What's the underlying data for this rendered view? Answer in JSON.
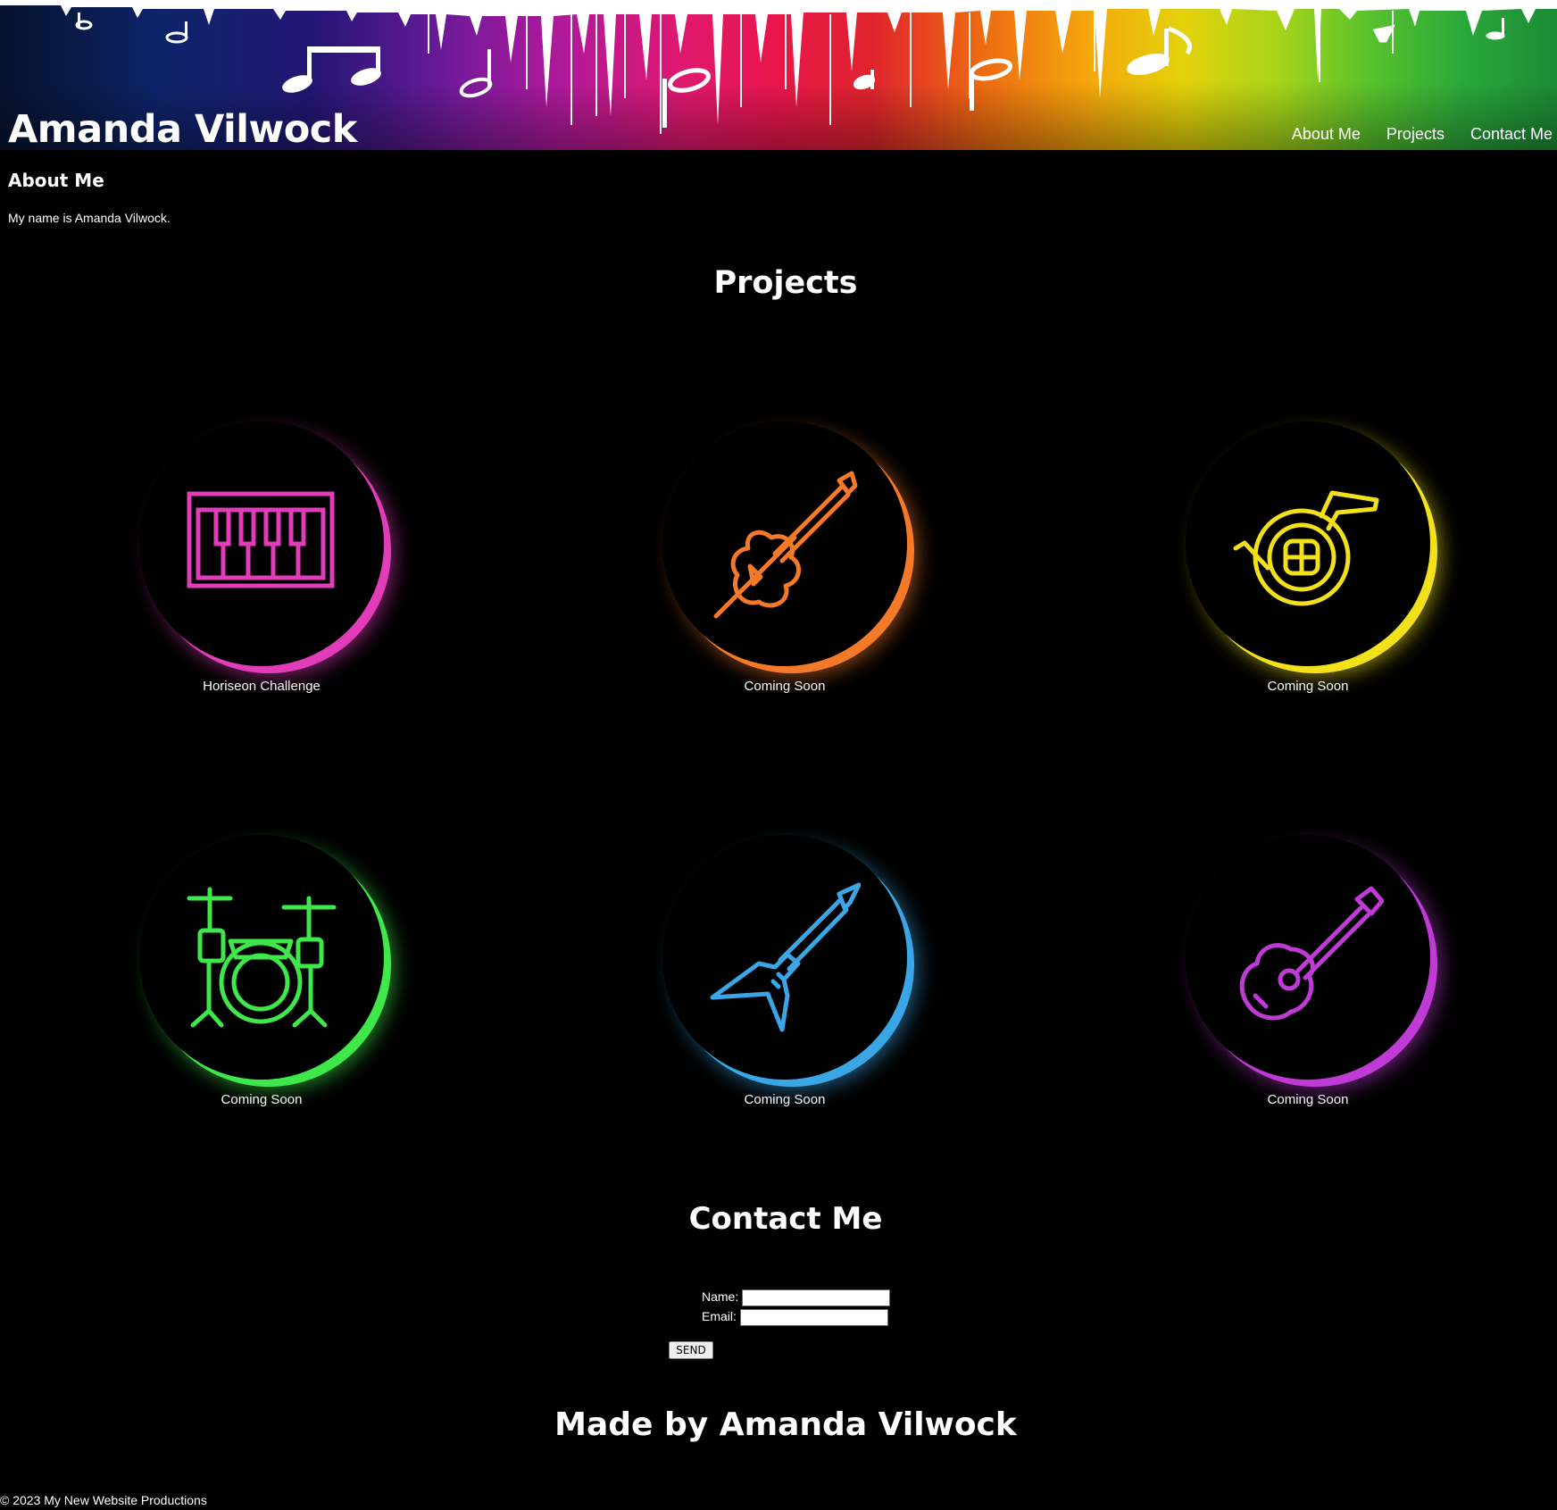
{
  "header": {
    "title": "Amanda Vilwock",
    "nav": [
      {
        "label": "About Me"
      },
      {
        "label": "Projects"
      },
      {
        "label": "Contact Me"
      }
    ]
  },
  "about": {
    "heading": "About Me",
    "text": "My name is Amanda Vilwock."
  },
  "projects": {
    "heading": "Projects",
    "items": [
      {
        "label": "Horiseon Challenge",
        "icon": "piano-keyboard-icon",
        "color": "#e23cb8"
      },
      {
        "label": "Coming Soon",
        "icon": "violin-icon",
        "color": "#f47a2a"
      },
      {
        "label": "Coming Soon",
        "icon": "french-horn-icon",
        "color": "#f2e01a"
      },
      {
        "label": "Coming Soon",
        "icon": "drum-kit-icon",
        "color": "#3ee84a"
      },
      {
        "label": "Coming Soon",
        "icon": "electric-guitar-icon",
        "color": "#3aa6e6"
      },
      {
        "label": "Coming Soon",
        "icon": "acoustic-guitar-icon",
        "color": "#c03ad6"
      }
    ]
  },
  "contact": {
    "heading": "Contact Me",
    "name_label": "Name:",
    "name_value": "",
    "email_label": "Email:",
    "email_value": "",
    "send_label": "SEND"
  },
  "footer": {
    "made_by": "Made by Amanda Vilwock",
    "copyright": "© 2023 My New Website Productions"
  }
}
